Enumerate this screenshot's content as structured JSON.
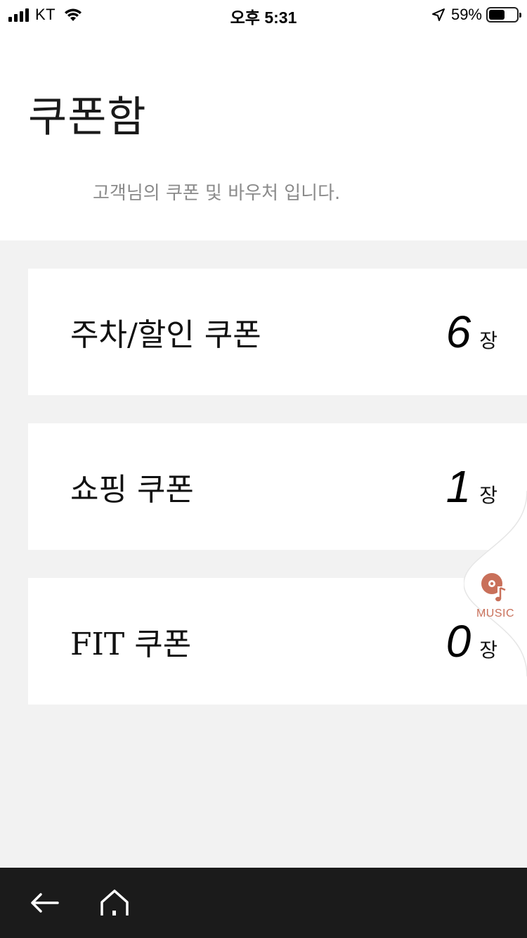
{
  "status_bar": {
    "carrier": "KT",
    "time": "오후 5:31",
    "battery_percent": "59%",
    "battery_level": 0.59,
    "icons": [
      "signal-icon",
      "wifi-icon",
      "location-arrow-icon",
      "battery-icon"
    ]
  },
  "header": {
    "title": "쿠폰함",
    "subtitle": "고객님의 쿠폰 및 바우처 입니다."
  },
  "coupons": [
    {
      "name": "주차/할인 쿠폰",
      "count": "6",
      "unit": "장"
    },
    {
      "name": "쇼핑 쿠폰",
      "count": "1",
      "unit": "장"
    },
    {
      "name": "FIT 쿠폰",
      "count": "0",
      "unit": "장"
    }
  ],
  "music_tab": {
    "label": "MUSIC",
    "icon": "music-disc-icon",
    "accent_color": "#c9705a"
  },
  "bottom_nav": {
    "items": [
      "back-arrow-icon",
      "home-icon"
    ],
    "background": "#1b1b1b"
  }
}
